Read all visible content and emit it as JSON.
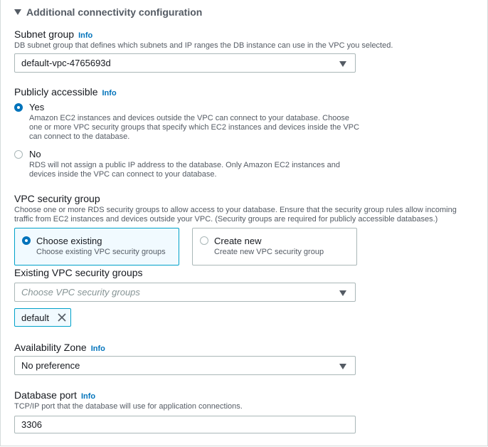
{
  "section": {
    "title": "Additional connectivity configuration"
  },
  "info_label": "Info",
  "subnet": {
    "label": "Subnet group",
    "description": "DB subnet group that defines which subnets and IP ranges the DB instance can use in the VPC you selected.",
    "value": "default-vpc-4765693d"
  },
  "public_access": {
    "label": "Publicly accessible",
    "options": [
      {
        "label": "Yes",
        "description": "Amazon EC2 instances and devices outside the VPC can connect to your database. Choose one or more VPC security groups that specify which EC2 instances and devices inside the VPC can connect to the database.",
        "selected": true
      },
      {
        "label": "No",
        "description": "RDS will not assign a public IP address to the database. Only Amazon EC2 instances and devices inside the VPC can connect to your database.",
        "selected": false
      }
    ]
  },
  "vpc_sg": {
    "label": "VPC security group",
    "description": "Choose one or more RDS security groups to allow access to your database. Ensure that the security group rules allow incoming traffic from EC2 instances and devices outside your VPC. (Security groups are required for publicly accessible databases.)",
    "options": [
      {
        "title": "Choose existing",
        "description": "Choose existing VPC security groups",
        "selected": true
      },
      {
        "title": "Create new",
        "description": "Create new VPC security group",
        "selected": false
      }
    ]
  },
  "existing_sg": {
    "label": "Existing VPC security groups",
    "placeholder": "Choose VPC security groups",
    "tokens": [
      "default"
    ]
  },
  "az": {
    "label": "Availability Zone",
    "value": "No preference"
  },
  "port": {
    "label": "Database port",
    "description": "TCP/IP port that the database will use for application connections.",
    "value": "3306"
  },
  "colors": {
    "link": "#0073bb",
    "selected_border": "#00a1c9",
    "selected_bg": "#f1faff"
  },
  "icons": {
    "expand": "caret-down-icon",
    "dropdown": "chevron-down-icon",
    "remove_token": "close-icon"
  }
}
